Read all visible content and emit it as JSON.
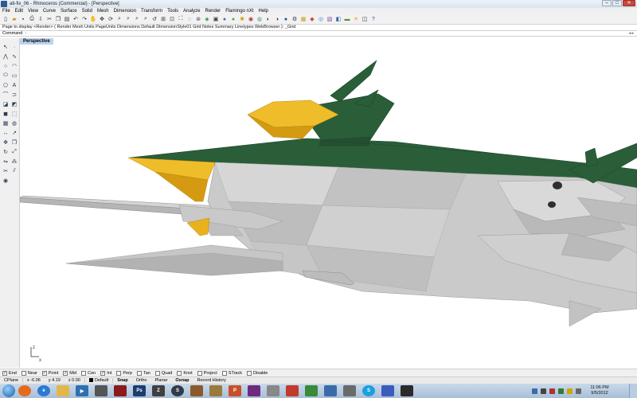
{
  "window": {
    "title": "alt-fix_06 - Rhinoceros (Commercial) - [Perspective]",
    "minimize": "–",
    "maximize": "□",
    "close": "✕"
  },
  "menu": [
    "File",
    "Edit",
    "View",
    "Curve",
    "Surface",
    "Solid",
    "Mesh",
    "Dimension",
    "Transform",
    "Tools",
    "Analyze",
    "Render",
    "Flamingo nXt",
    "Help"
  ],
  "command": {
    "history": "Page to display <Render> ( Render Mesh Units PageUnits Dimensions Default DimensionStyle01 Grid Notes Summary Linetypes WebBrowser ): _Grid",
    "prompt_label": "Command",
    "value": "",
    "placeholder": "",
    "scroll_buttons": "◂ ▸"
  },
  "viewport": {
    "tab_label": "Perspective",
    "axis_z": "z",
    "axis_x": "x",
    "colors": {
      "hull": "#c8c8c8",
      "hull_dark": "#a9a9a9",
      "canopy_green": "#2a5e39",
      "nose_yellow": "#e9b21d",
      "yellow_dark": "#d49a12"
    }
  },
  "osnap": [
    {
      "label": "End",
      "checked": true
    },
    {
      "label": "Near",
      "checked": false
    },
    {
      "label": "Point",
      "checked": true
    },
    {
      "label": "Mid",
      "checked": true
    },
    {
      "label": "Cen",
      "checked": false
    },
    {
      "label": "Int",
      "checked": true
    },
    {
      "label": "Perp",
      "checked": false
    },
    {
      "label": "Tan",
      "checked": false
    },
    {
      "label": "Quad",
      "checked": false
    },
    {
      "label": "Knot",
      "checked": false
    },
    {
      "label": "Project",
      "checked": false
    },
    {
      "label": "STrack",
      "checked": false
    },
    {
      "label": "Disable",
      "checked": false
    }
  ],
  "status": {
    "cplane": "CPlane",
    "x": "x -6.06",
    "y": "y 4.19",
    "z": "z 0.00",
    "layer": "Default",
    "snap": "Snap",
    "ortho": "Ortho",
    "planar": "Planar",
    "osnap": "Osnap",
    "record_history": "Record History"
  },
  "taskbar": {
    "apps": [
      {
        "name": "firefox",
        "label": "",
        "color": "#e66a1a"
      },
      {
        "name": "internet-explorer",
        "label": "e",
        "color": "#2a7ad0"
      },
      {
        "name": "explorer",
        "label": "",
        "color": "#e2b64a"
      },
      {
        "name": "media-player",
        "label": "▶",
        "color": "#2f6fb0"
      },
      {
        "name": "game",
        "label": "",
        "color": "#555555"
      },
      {
        "name": "rhino",
        "label": "",
        "color": "#8b1a1a"
      },
      {
        "name": "photoshop",
        "label": "Ps",
        "color": "#1b3d6e"
      },
      {
        "name": "zbrush",
        "label": "Z",
        "color": "#404040"
      },
      {
        "name": "steam",
        "label": "S",
        "color": "#303a48"
      },
      {
        "name": "app-10",
        "label": "",
        "color": "#8a5a2a"
      },
      {
        "name": "app-11",
        "label": "",
        "color": "#9a7b3c"
      },
      {
        "name": "powerpoint",
        "label": "P",
        "color": "#c7502b"
      },
      {
        "name": "app-13",
        "label": "",
        "color": "#6d2b7d"
      },
      {
        "name": "app-14",
        "label": "",
        "color": "#888888"
      },
      {
        "name": "app-15",
        "label": "",
        "color": "#c23a2b"
      },
      {
        "name": "app-16",
        "label": "",
        "color": "#3a8a3a"
      },
      {
        "name": "app-17",
        "label": "",
        "color": "#3a6aa8"
      },
      {
        "name": "app-18",
        "label": "",
        "color": "#6a6a6a"
      },
      {
        "name": "skype",
        "label": "S",
        "color": "#1aa0e0"
      },
      {
        "name": "app-20",
        "label": "",
        "color": "#3b5bbd"
      },
      {
        "name": "app-21",
        "label": "",
        "color": "#2a2a2a"
      }
    ],
    "time": "11:06 PM",
    "date": "9/5/2012"
  }
}
